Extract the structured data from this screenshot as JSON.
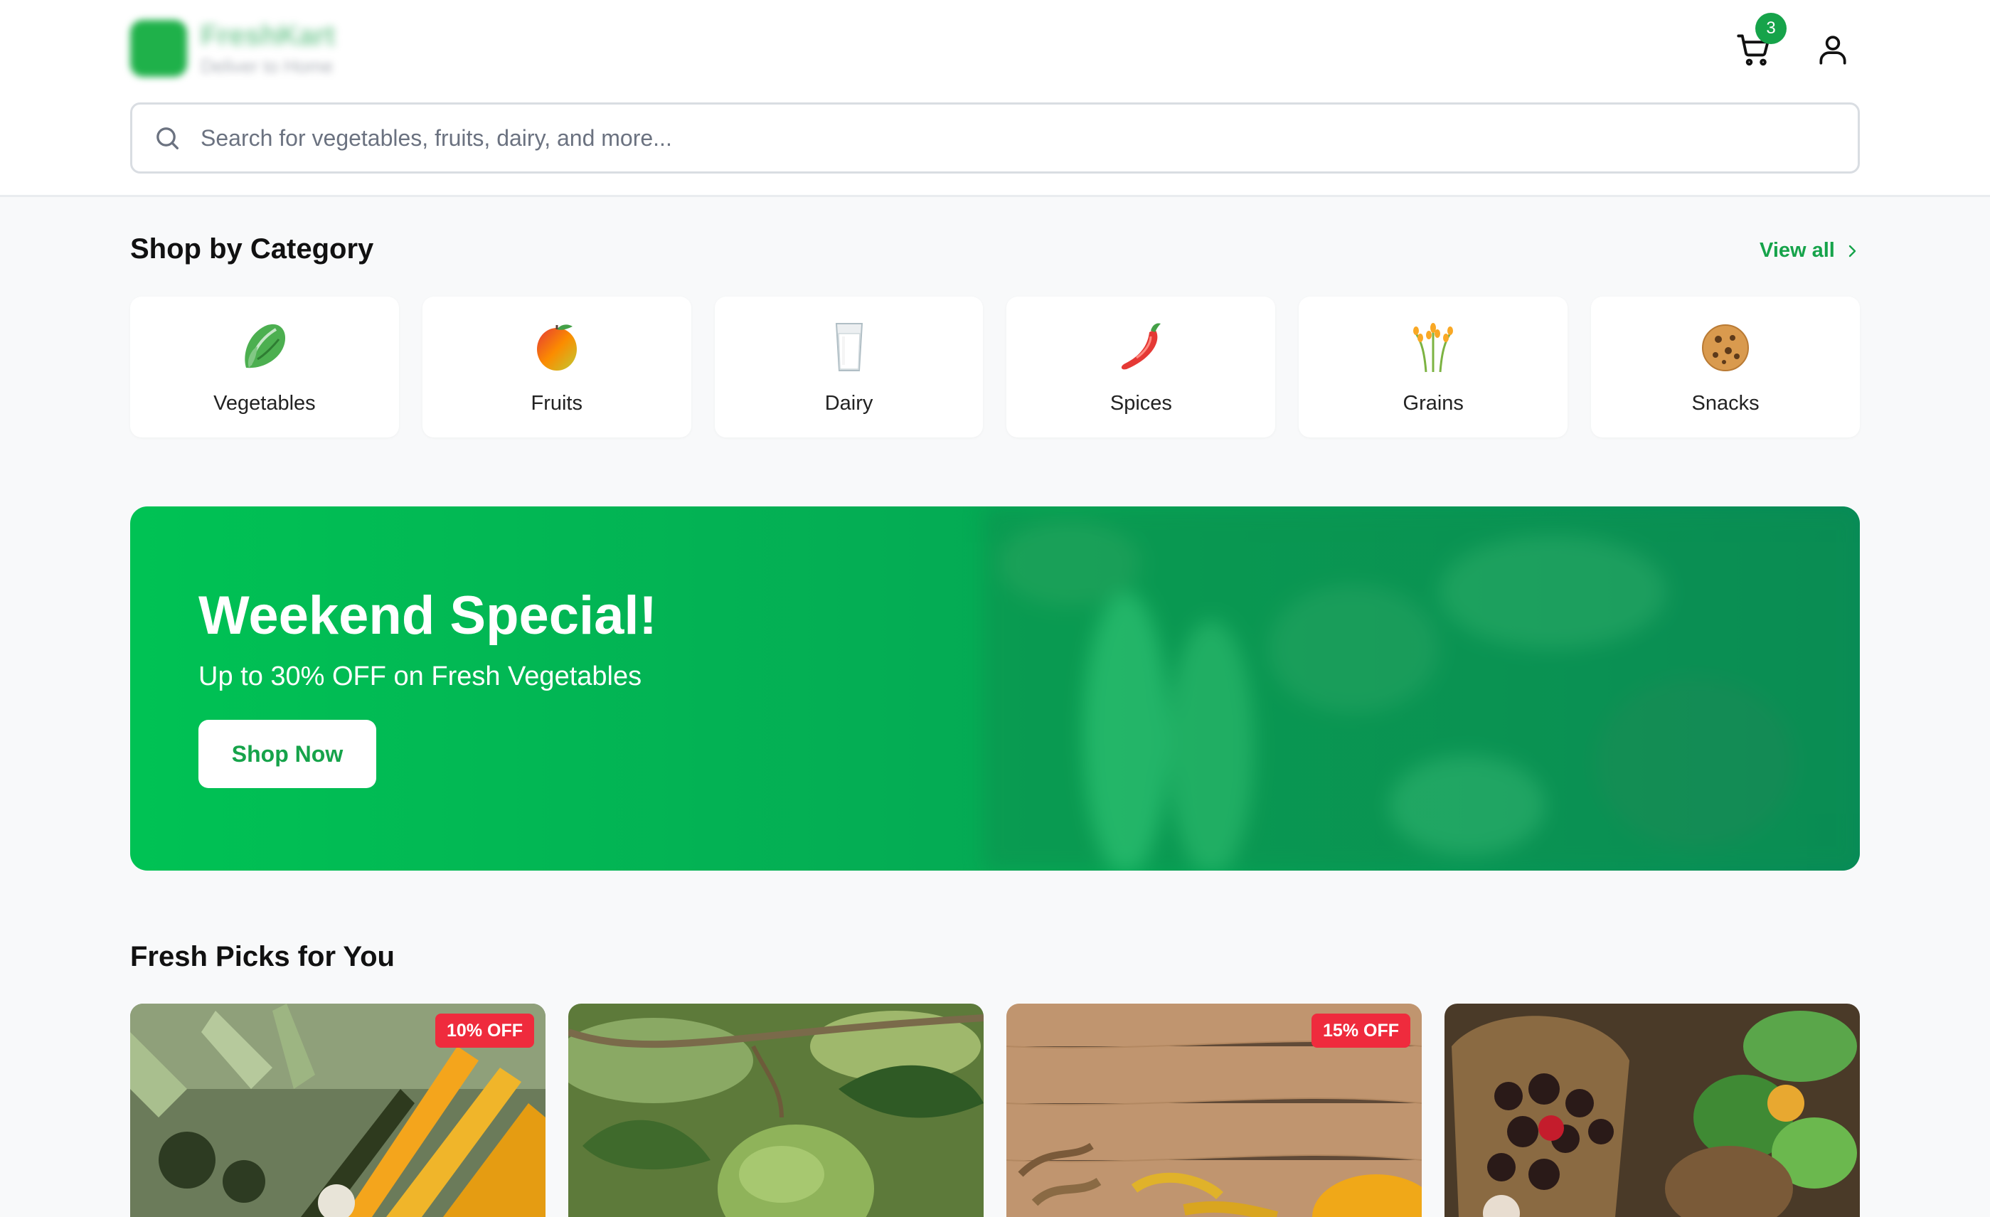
{
  "header": {
    "brand": {
      "name": "FreshKart",
      "tagline": "Deliver to Home"
    },
    "cart": {
      "count": "3"
    },
    "search": {
      "placeholder": "Search for vegetables, fruits, dairy, and more..."
    }
  },
  "categories_section": {
    "title": "Shop by Category",
    "view_all_label": "View all",
    "items": [
      {
        "label": "Vegetables",
        "icon": "lettuce-icon"
      },
      {
        "label": "Fruits",
        "icon": "mango-icon"
      },
      {
        "label": "Dairy",
        "icon": "milk-glass-icon"
      },
      {
        "label": "Spices",
        "icon": "chili-pepper-icon"
      },
      {
        "label": "Grains",
        "icon": "rice-sheaf-icon"
      },
      {
        "label": "Snacks",
        "icon": "cookie-icon"
      }
    ]
  },
  "banner": {
    "title": "Weekend Special!",
    "subtitle": "Up to 30% OFF on Fresh Vegetables",
    "cta_label": "Shop Now"
  },
  "products_section": {
    "title": "Fresh Picks for You",
    "items": [
      {
        "image": "vegetables-photo",
        "badge": "10% OFF"
      },
      {
        "image": "mango-tree-photo",
        "badge": ""
      },
      {
        "image": "spices-photo",
        "badge": "15% OFF"
      },
      {
        "image": "vegetable-basket-photo",
        "badge": ""
      }
    ]
  },
  "colors": {
    "brand_green": "#16a34a",
    "banner_green": "#00c254",
    "discount_red": "#ef2b3d",
    "background": "#f8f9fa"
  }
}
